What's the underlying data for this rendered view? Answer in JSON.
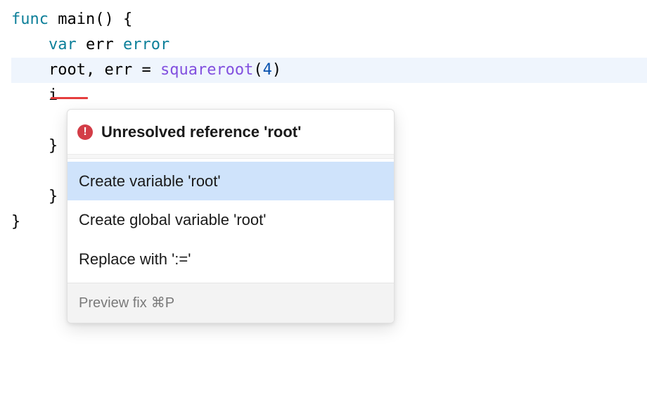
{
  "code": {
    "l1_func": "func",
    "l1_name": "main",
    "l1_parens": "() {",
    "l2_var": "var",
    "l2_ident": "err",
    "l2_type": "error",
    "l3_root": "root",
    "l3_comma": ", ",
    "l3_err": "err",
    "l3_eq": " = ",
    "l3_call": "squareroot",
    "l3_open": "(",
    "l3_num": "4",
    "l3_close": ")",
    "l4_partial": "i",
    "l5_brace": "}",
    "l6_brace": "}",
    "l7_brace": "}"
  },
  "popup": {
    "title": "Unresolved reference 'root'",
    "items": [
      "Create variable 'root'",
      "Create global variable 'root'",
      "Replace with ':='"
    ],
    "footer_label": "Preview fix",
    "footer_shortcut": "⌘P"
  }
}
